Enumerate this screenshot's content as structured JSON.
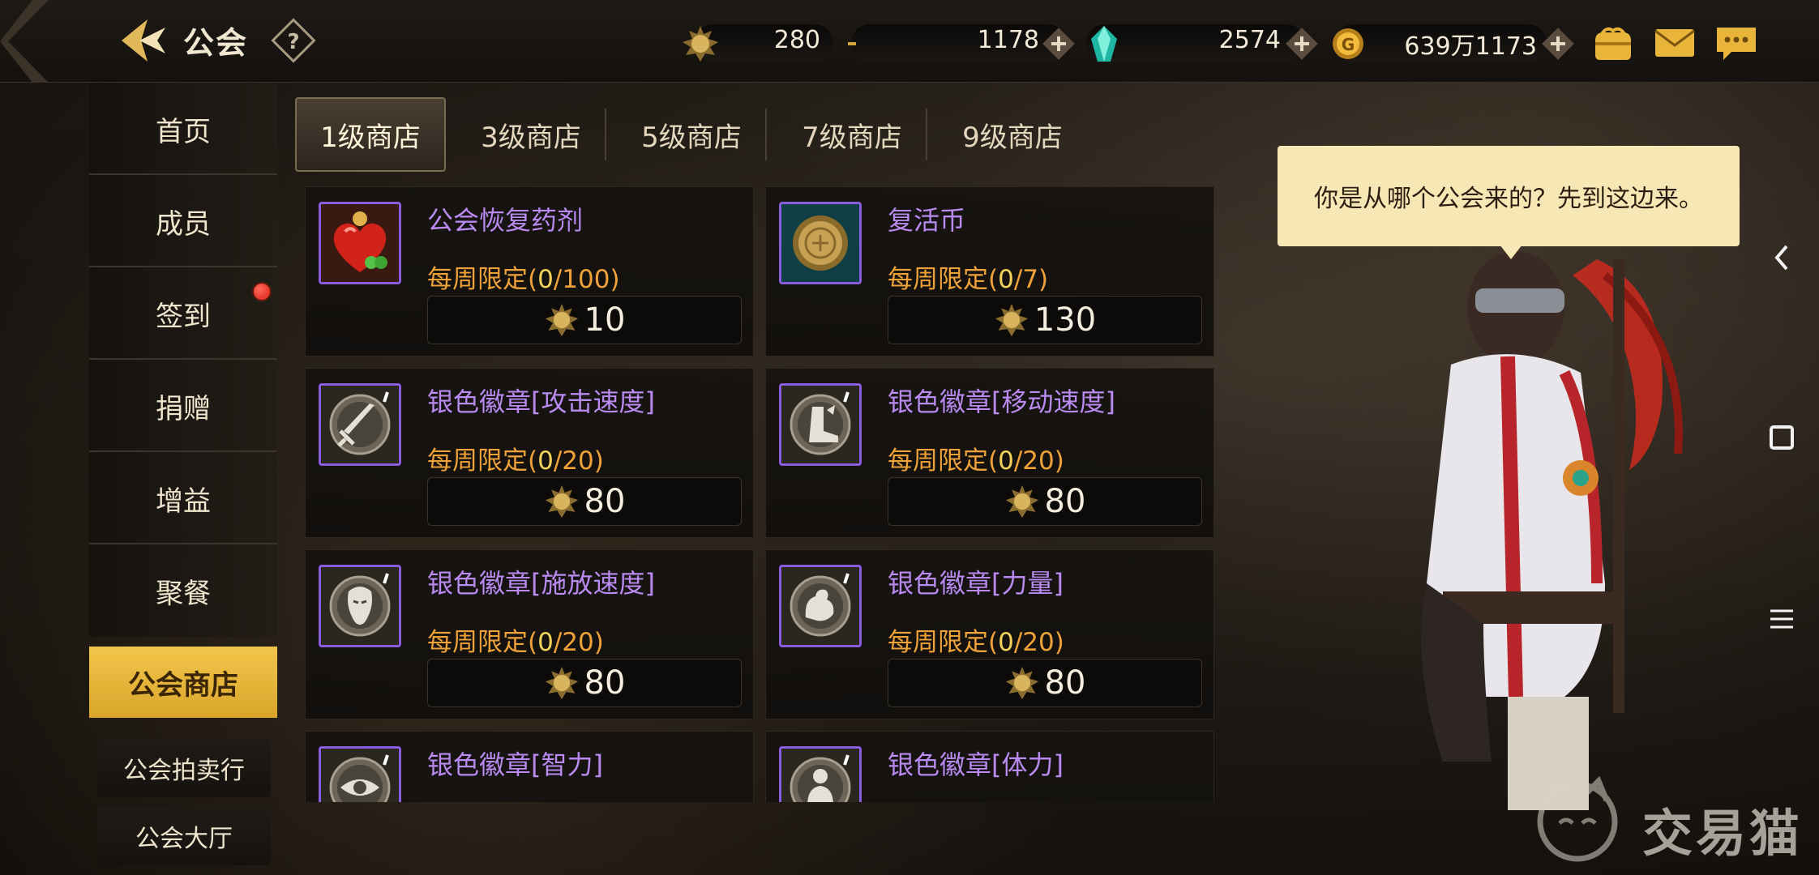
{
  "header": {
    "title": "公会",
    "back_icon": "back-arrow-icon",
    "help_icon": "question-mark-icon"
  },
  "currencies": [
    {
      "icon": "guild-coin-icon",
      "value": "280",
      "addable": false
    },
    {
      "icon": "crescent-token-icon",
      "value": "1178",
      "addable": true
    },
    {
      "icon": "crystal-icon",
      "value": "2574",
      "addable": true
    },
    {
      "icon": "gold-coin-icon",
      "value": "639万1173",
      "addable": true
    }
  ],
  "top_icons": [
    "wallet-icon",
    "mail-icon",
    "chat-icon"
  ],
  "sidebar": {
    "items": [
      {
        "label": "首页"
      },
      {
        "label": "成员"
      },
      {
        "label": "签到",
        "has_notification": true
      },
      {
        "label": "捐赠"
      },
      {
        "label": "增益"
      },
      {
        "label": "聚餐"
      },
      {
        "label": "公会商店",
        "active": true
      }
    ],
    "sub_items": [
      {
        "label": "公会拍卖行"
      },
      {
        "label": "公会大厅"
      }
    ]
  },
  "tabs": [
    {
      "label": "1级商店",
      "active": true
    },
    {
      "label": "3级商店"
    },
    {
      "label": "5级商店"
    },
    {
      "label": "7级商店"
    },
    {
      "label": "9级商店"
    }
  ],
  "shop": {
    "limit_prefix": "每周限定(",
    "items": [
      {
        "name": "公会恢复药剂",
        "icon": "heart-potion-icon",
        "bought": "0",
        "limit": "/100)",
        "price": "10"
      },
      {
        "name": "复活币",
        "icon": "resurrection-coin-icon",
        "bought": "0",
        "limit": "/7)",
        "price": "130"
      },
      {
        "name": "银色徽章[攻击速度]",
        "icon": "sword-emblem-icon",
        "bought": "0",
        "limit": "/20)",
        "price": "80"
      },
      {
        "name": "银色徽章[移动速度]",
        "icon": "boot-emblem-icon",
        "bought": "0",
        "limit": "/20)",
        "price": "80"
      },
      {
        "name": "银色徽章[施放速度]",
        "icon": "face-emblem-icon",
        "bought": "0",
        "limit": "/20)",
        "price": "80"
      },
      {
        "name": "银色徽章[力量]",
        "icon": "muscle-emblem-icon",
        "bought": "0",
        "limit": "/20)",
        "price": "80"
      },
      {
        "name": "银色徽章[智力]",
        "icon": "eye-emblem-icon"
      },
      {
        "name": "银色徽章[体力]",
        "icon": "heart-body-emblem-icon"
      }
    ]
  },
  "npc": {
    "speech": "你是从哪个公会来的？先到这边来。"
  },
  "system_nav": [
    "nav-back-icon",
    "nav-home-icon",
    "nav-menu-icon"
  ],
  "watermark": {
    "text": "交易猫"
  },
  "colors": {
    "accent_gold": "#e8b43a",
    "item_name_purple": "#b98af0",
    "limit_orange": "#f0a23a",
    "limit_count_yellow": "#f4d25a"
  }
}
